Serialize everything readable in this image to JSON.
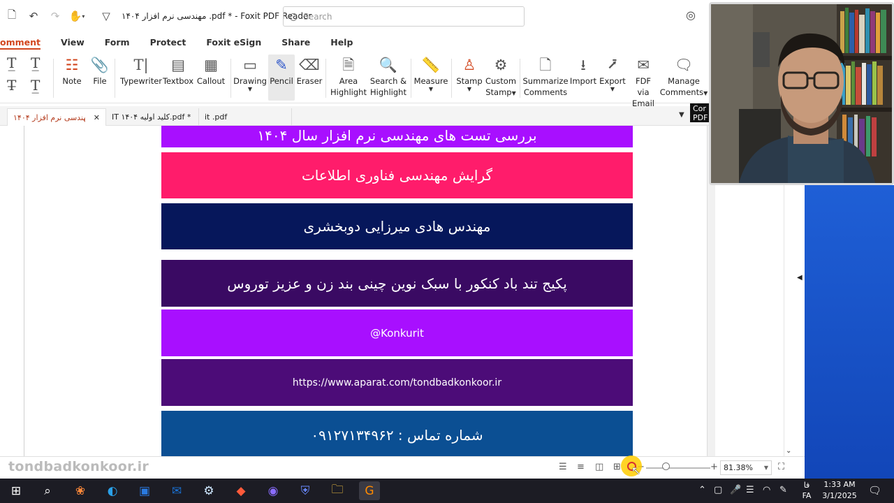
{
  "window": {
    "title": "مهندسی نرم افزار ۱۴۰۴ .pdf * - Foxit PDF Reader",
    "search_placeholder": "Search"
  },
  "menu": {
    "items": [
      "omment",
      "View",
      "Form",
      "Protect",
      "Foxit eSign",
      "Share",
      "Help"
    ]
  },
  "ribbon": {
    "note": "Note",
    "file": "File",
    "typewriter": "Typewriter",
    "textbox": "Textbox",
    "callout": "Callout",
    "drawing": "Drawing",
    "pencil": "Pencil",
    "eraser": "Eraser",
    "area_highlight_1": "Area",
    "area_highlight_2": "Highlight",
    "search_highlight_1": "Search &",
    "search_highlight_2": "Highlight",
    "measure": "Measure",
    "stamp": "Stamp",
    "custom_stamp_1": "Custom",
    "custom_stamp_2": "Stamp",
    "summarize_1": "Summarize",
    "summarize_2": "Comments",
    "import": "Import",
    "export": "Export",
    "fdf_1": "FDF via",
    "fdf_2": "Email",
    "manage_1": "Manage",
    "manage_2": "Comments"
  },
  "doc_tabs": [
    {
      "label": "مهندسی نرم افزار ۱۴۰۴..."
    },
    {
      "label": "IT ۱۴۰۴ کلید اولیه.pdf *"
    },
    {
      "label": "it .pdf"
    }
  ],
  "corner_label": "Cor PDF",
  "document": {
    "banners": [
      {
        "text": "بررسی تست های مهندسی نرم افزار  سال ۱۴۰۴",
        "color": "#a80fff"
      },
      {
        "text": "گرایش مهندسی فناوری اطلاعات",
        "color": "#ff1c6b"
      },
      {
        "text": "مهندس هادی میرزایی دوبخشری",
        "color": "#06175b"
      },
      {
        "text": "پکیج تند باد کنکور  با سبک نوین چینی بند زن و عزیز توروس",
        "color": "#3a0a63"
      },
      {
        "text": "@Konkurit",
        "color": "#a80fff"
      },
      {
        "text": "https://www.aparat.com/tondbadkonkoor.ir",
        "color": "#4c0c78"
      },
      {
        "text": "شماره تماس : ۰۹۱۲۷۱۳۴۹۶۲",
        "color": "#0b4f93"
      }
    ]
  },
  "statusbar": {
    "watermark": "tondbadkonkoor.ir",
    "zoom": "81.38%"
  },
  "taskbar": {
    "language_1": "فا",
    "language_2": "FA",
    "time": "1:33 AM",
    "date": "3/1/2025"
  }
}
